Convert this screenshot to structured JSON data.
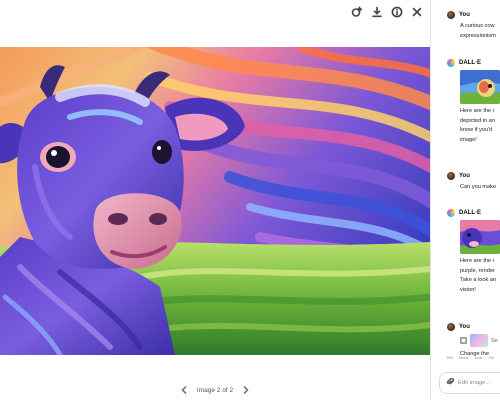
{
  "toolbar": {
    "icons": [
      "edit-sparkle-icon",
      "download-icon",
      "info-icon",
      "close-icon"
    ]
  },
  "artwork": {
    "subject": "cow-painting",
    "colors": {
      "purple": "#5a3fd1",
      "blue": "#2f4fd8",
      "orange": "#f08a3e",
      "pink": "#e66aa6",
      "green": "#6fbf3a"
    }
  },
  "pager": {
    "label": "Image 2 of 2"
  },
  "chat": {
    "messages": [
      {
        "sender": "You",
        "lines": [
          "A curious cow",
          "expressionism"
        ]
      },
      {
        "sender": "DALL·E",
        "has_image": true,
        "lines": [
          "Here are the i",
          "depicted in an",
          "know if you'd",
          "image!"
        ]
      },
      {
        "sender": "You",
        "lines": [
          "Can you make"
        ]
      },
      {
        "sender": "DALL·E",
        "has_image": true,
        "lines": [
          "Here are the i",
          "purple, render",
          "Take a look an",
          "vision!"
        ]
      },
      {
        "sender": "You",
        "attachment_label": "Se",
        "lines": [
          "Change the"
        ]
      }
    ],
    "chips": [
      "Pet",
      "Stone",
      "Dots",
      "Fal"
    ],
    "composer_placeholder": "Edit image..."
  }
}
